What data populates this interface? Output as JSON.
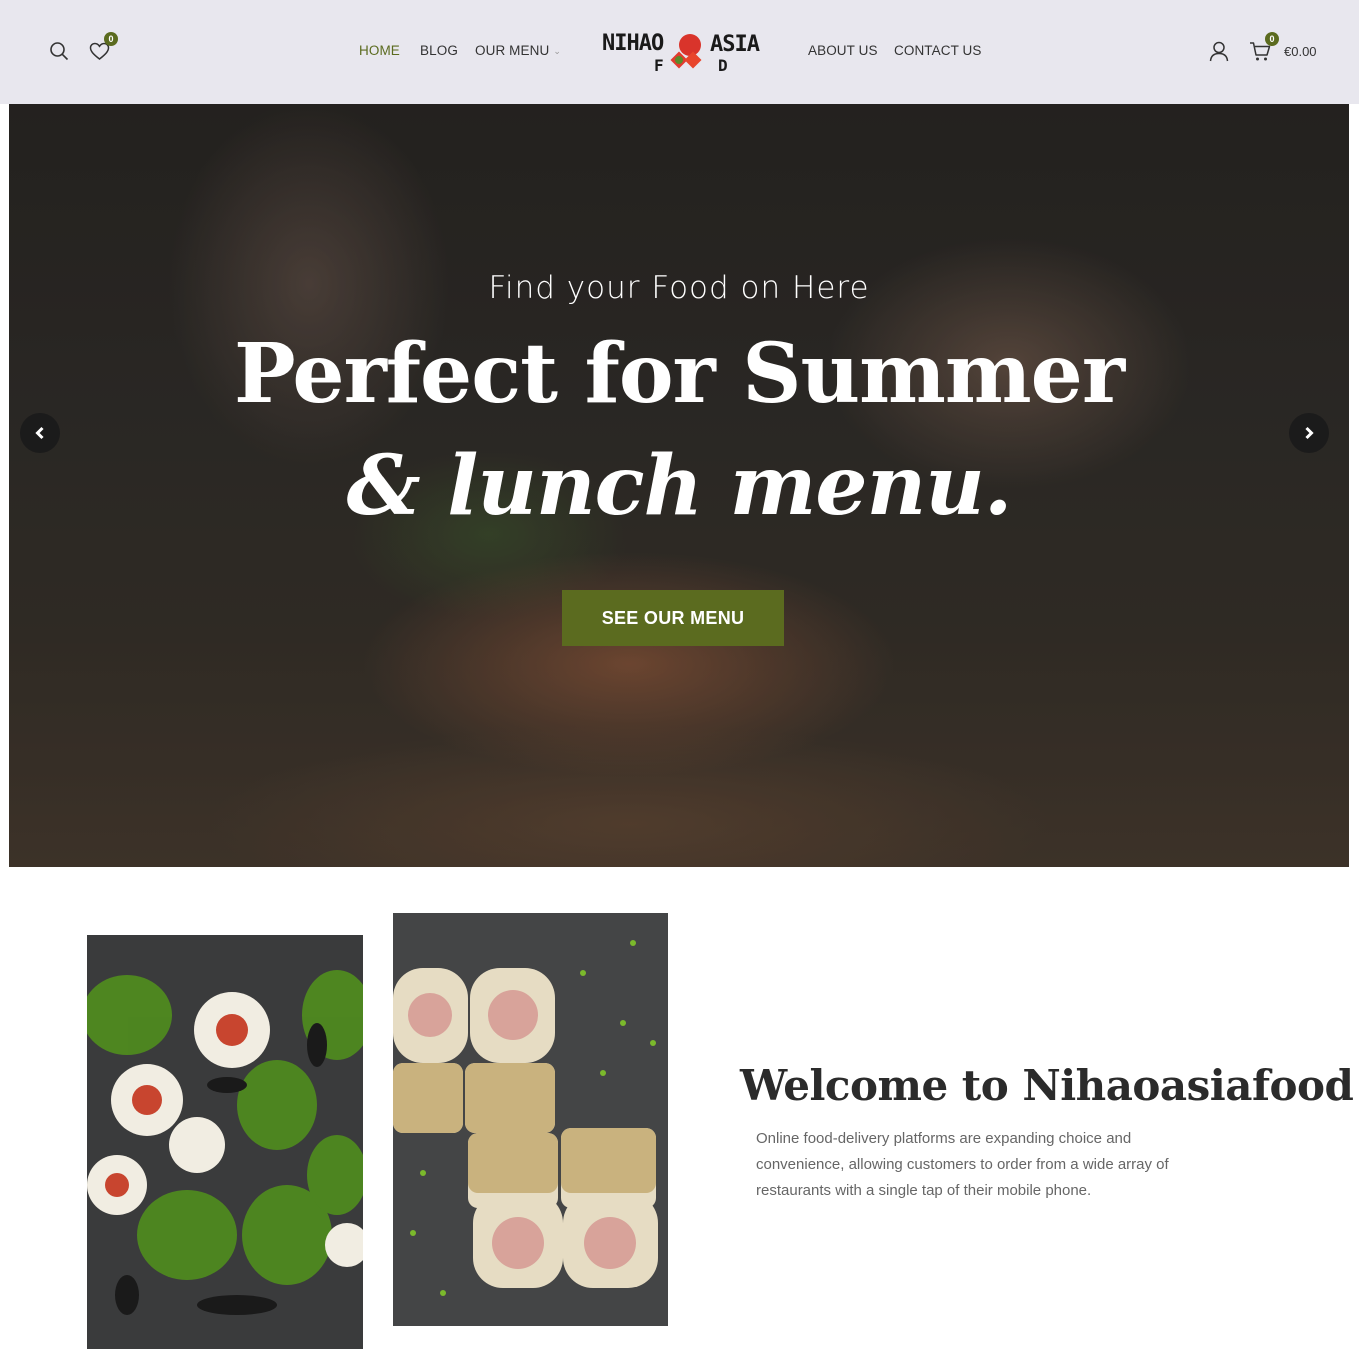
{
  "header": {
    "wishlist_count": "0",
    "cart_count": "0",
    "cart_total": "€0.00",
    "nav_left": [
      {
        "label": "HOME",
        "active": true
      },
      {
        "label": "BLOG",
        "active": false
      },
      {
        "label": "OUR MENU",
        "active": false
      }
    ],
    "nav_right": [
      {
        "label": "ABOUT US"
      },
      {
        "label": "CONTACT US"
      }
    ],
    "logo_text": "NIHAO ASIA FOOD",
    "icons": [
      "search-icon",
      "heart-icon",
      "user-icon",
      "cart-icon",
      "chevron-down-icon"
    ]
  },
  "hero": {
    "subtitle": "Find your Food on Here",
    "title_line1": "Perfect for Summer",
    "title_line2": "& lunch menu.",
    "button_label": "SEE OUR MENU",
    "prev_icon": "chevron-left-icon",
    "next_icon": "chevron-right-icon"
  },
  "about": {
    "heading": "Welcome to Nihaoasiafood",
    "text": "Online food-delivery platforms are expanding choice and convenience, allowing customers to order from a wide array of restaurants with a single tap of their mobile phone."
  },
  "colors": {
    "accent": "#5b6b1f",
    "header_bg": "#e8e7ee"
  }
}
